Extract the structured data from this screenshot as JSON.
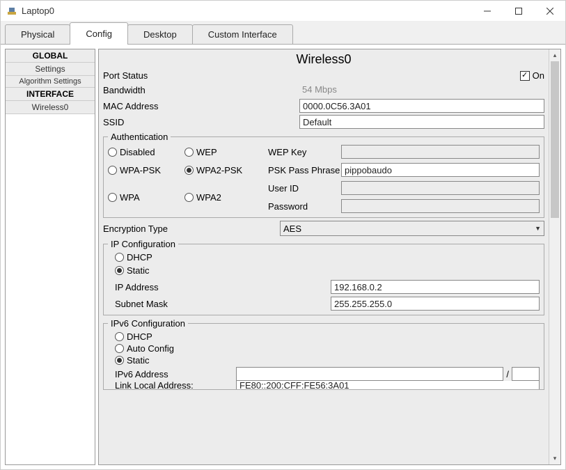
{
  "window": {
    "title": "Laptop0"
  },
  "tabs": {
    "physical": "Physical",
    "config": "Config",
    "desktop": "Desktop",
    "custom": "Custom Interface"
  },
  "sidebar": {
    "global_hdr": "GLOBAL",
    "settings": "Settings",
    "algo": "Algorithm Settings",
    "iface_hdr": "INTERFACE",
    "wireless0": "Wireless0"
  },
  "panel": {
    "title": "Wireless0",
    "port_status_label": "Port Status",
    "port_status_on": "On",
    "bandwidth_label": "Bandwidth",
    "bandwidth_value": "54 Mbps",
    "mac_label": "MAC Address",
    "mac_value": "0000.0C56.3A01",
    "ssid_label": "SSID",
    "ssid_value": "Default"
  },
  "auth": {
    "legend": "Authentication",
    "disabled": "Disabled",
    "wep": "WEP",
    "wep_key_label": "WEP Key",
    "wep_key_value": "",
    "wpa_psk": "WPA-PSK",
    "wpa2_psk": "WPA2-PSK",
    "psk_label": "PSK Pass Phrase",
    "psk_value": "pippobaudo",
    "wpa": "WPA",
    "wpa2": "WPA2",
    "userid_label": "User ID",
    "userid_value": "",
    "password_label": "Password",
    "password_value": "",
    "enc_label": "Encryption Type",
    "enc_value": "AES"
  },
  "ip": {
    "legend": "IP Configuration",
    "dhcp": "DHCP",
    "static": "Static",
    "ip_label": "IP Address",
    "ip_value": "192.168.0.2",
    "mask_label": "Subnet Mask",
    "mask_value": "255.255.255.0"
  },
  "ipv6": {
    "legend": "IPv6 Configuration",
    "dhcp": "DHCP",
    "auto": "Auto Config",
    "static": "Static",
    "addr_label": "IPv6 Address",
    "addr_value": "",
    "prefix_value": "",
    "lla_label": "Link Local Address:",
    "lla_value": "FE80::200:CFF:FE56:3A01"
  }
}
